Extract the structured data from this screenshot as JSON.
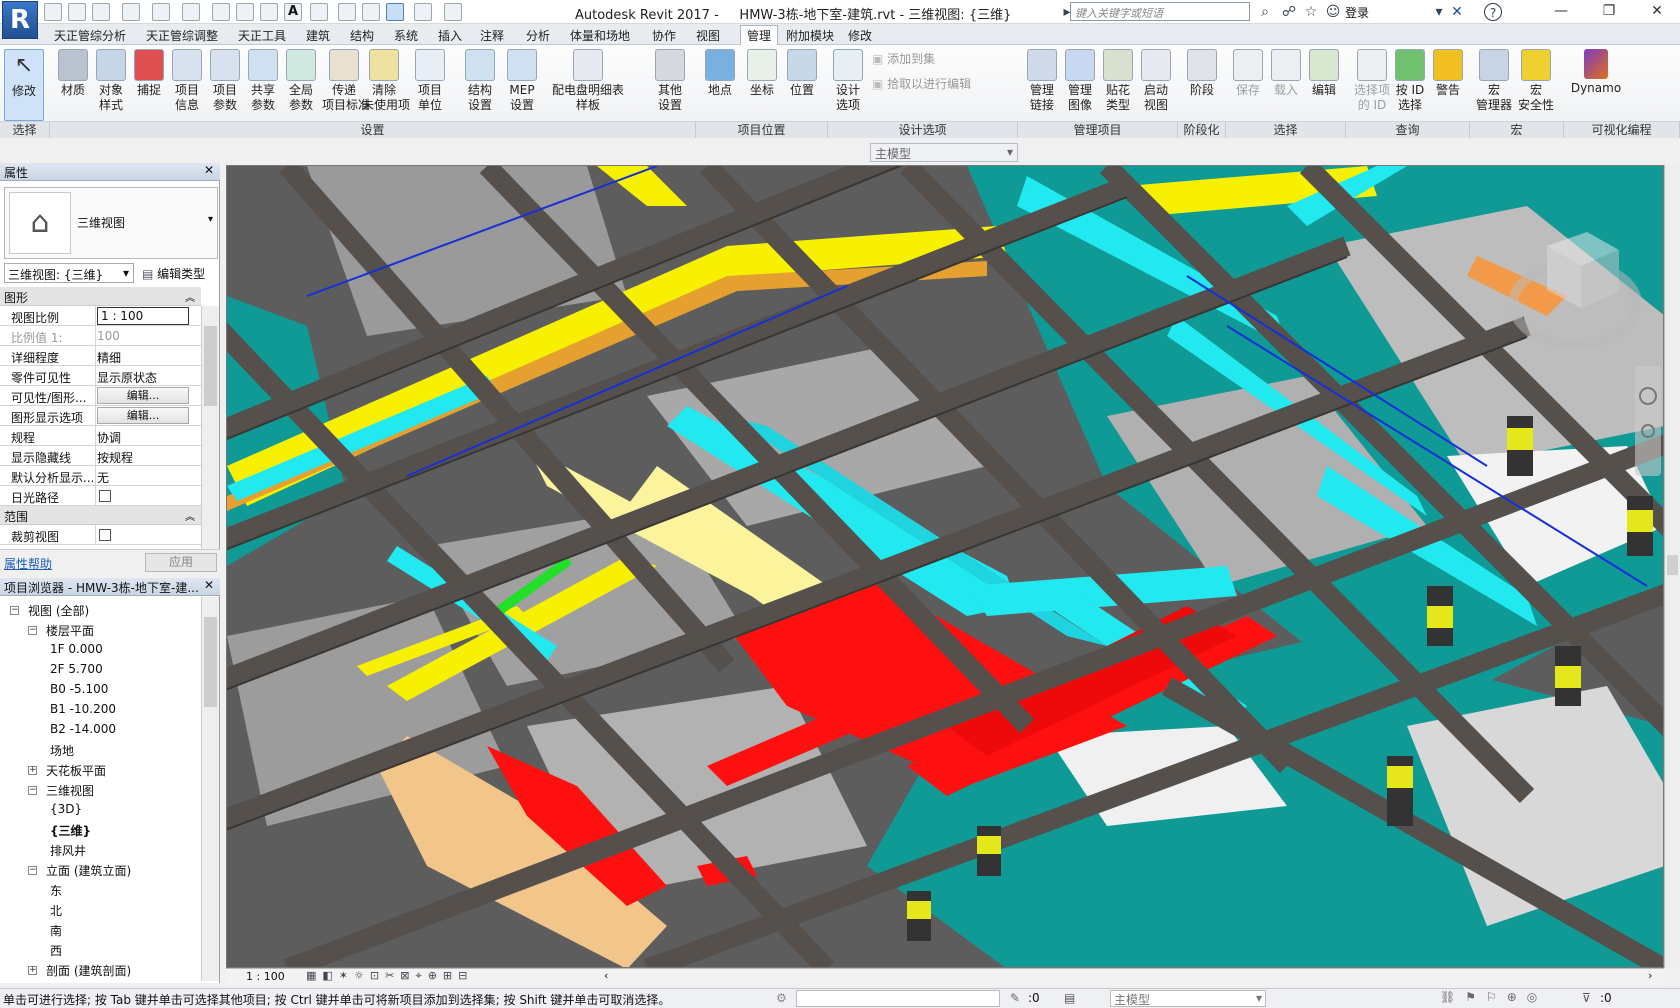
{
  "app": {
    "logo_letter": "R",
    "title": "Autodesk Revit 2017 -     HMW-3栋-地下室-建筑.rvt - 三维视图: {三维}",
    "search_placeholder": "键入关键字或短语",
    "login": "登录"
  },
  "tabs": [
    "天正管综分析",
    "天正管综调整",
    "天正工具",
    "建筑",
    "结构",
    "系统",
    "插入",
    "注释",
    "分析",
    "体量和场地",
    "协作",
    "视图",
    "管理",
    "附加模块",
    "修改"
  ],
  "active_tab": "管理",
  "ribbon": {
    "select": {
      "modify": "修改",
      "select_label": "选择 ▾"
    },
    "settings_buttons": [
      {
        "l1": "材质",
        "l2": ""
      },
      {
        "l1": "对象",
        "l2": "样式"
      },
      {
        "l1": "捕捉",
        "l2": ""
      },
      {
        "l1": "项目",
        "l2": "信息"
      },
      {
        "l1": "项目",
        "l2": "参数"
      },
      {
        "l1": "共享",
        "l2": "参数"
      },
      {
        "l1": "全局",
        "l2": "参数"
      },
      {
        "l1": "传递",
        "l2": "项目标准"
      },
      {
        "l1": "清除",
        "l2": "未使用项"
      },
      {
        "l1": "项目",
        "l2": "单位"
      },
      {
        "l1": "结构",
        "l2": "设置"
      },
      {
        "l1": "MEP",
        "l2": "设置"
      },
      {
        "l1": "配电盘明细表",
        "l2": "样板"
      },
      {
        "l1": "其他",
        "l2": "设置"
      }
    ],
    "location_buttons": [
      {
        "l1": "地点",
        "l2": ""
      },
      {
        "l1": "坐标",
        "l2": ""
      },
      {
        "l1": "位置",
        "l2": ""
      }
    ],
    "design_options": {
      "btn_l1": "设计",
      "btn_l2": "选项",
      "add_to_set": "添加到集",
      "pick_to_edit": "拾取以进行编辑",
      "main_model": "主模型"
    },
    "manage_project_buttons": [
      {
        "l1": "管理",
        "l2": "链接"
      },
      {
        "l1": "管理",
        "l2": "图像"
      },
      {
        "l1": "贴花",
        "l2": "类型"
      },
      {
        "l1": "启动",
        "l2": "视图"
      }
    ],
    "phase_button": {
      "l1": "阶段",
      "l2": ""
    },
    "selection_buttons": [
      {
        "l1": "保存",
        "l2": "",
        "disabled": true
      },
      {
        "l1": "载入",
        "l2": "",
        "disabled": true
      },
      {
        "l1": "编辑",
        "l2": "",
        "disabled": false
      }
    ],
    "inquiry_buttons": [
      {
        "l1": "选择项",
        "l2": "的 ID",
        "disabled": true
      },
      {
        "l1": "按 ID",
        "l2": "选择",
        "disabled": false
      },
      {
        "l1": "警告",
        "l2": "",
        "disabled": false
      }
    ],
    "macro_buttons": [
      {
        "l1": "宏",
        "l2": "管理器"
      },
      {
        "l1": "宏",
        "l2": "安全性"
      }
    ],
    "dynamo": "Dynamo",
    "panels": [
      "选择",
      "设置",
      "项目位置",
      "设计选项",
      "管理项目",
      "阶段化",
      "选择",
      "查询",
      "宏",
      "可视化编程"
    ]
  },
  "properties": {
    "title": "属性",
    "type_name": "三维视图",
    "instance_selector": "三维视图: {三维}",
    "edit_type": "编辑类型",
    "group_graphics": "图形",
    "rows": [
      {
        "k": "视图比例",
        "v": "1 : 100"
      },
      {
        "k": "比例值 1:",
        "v": "100"
      },
      {
        "k": "详细程度",
        "v": "精细"
      },
      {
        "k": "零件可见性",
        "v": "显示原状态"
      },
      {
        "k": "可见性/图形...",
        "v": "编辑..."
      },
      {
        "k": "图形显示选项",
        "v": "编辑..."
      },
      {
        "k": "规程",
        "v": "协调"
      },
      {
        "k": "显示隐藏线",
        "v": "按规程"
      },
      {
        "k": "默认分析显示...",
        "v": "无"
      },
      {
        "k": "日光路径",
        "v": ""
      }
    ],
    "group_extents": "范围",
    "crop_view": "裁剪视图",
    "help": "属性帮助",
    "apply": "应用"
  },
  "browser": {
    "title": "项目浏览器 - HMW-3栋-地下室-建...",
    "root": "视图 (全部)",
    "floor_plans": "楼层平面",
    "levels": [
      "1F  0.000",
      "2F  5.700",
      "B0 -5.100",
      "B1 -10.200",
      "B2  -14.000",
      "场地"
    ],
    "ceiling_plans": "天花板平面",
    "views_3d": "三维视图",
    "views_3d_items": [
      "{3D}",
      "{三维}",
      "排风井"
    ],
    "elevations": "立面 (建筑立面)",
    "elevation_items": [
      "东",
      "北",
      "南",
      "西"
    ],
    "sections": "剖面 (建筑剖面)"
  },
  "viewbar": {
    "scale": "1 : 100"
  },
  "status": {
    "message": "单击可进行选择; 按 Tab 键并单击可选择其他项目; 按 Ctrl 键并单击可将新项目添加到选择集; 按 Shift 键并单击可取消选择。",
    "workset_count": ":0",
    "main_model": "主模型",
    "filter_count": ":0"
  },
  "colors": {
    "ribbon_accent": "#2c6bb8",
    "yellow_duct": "#f7f100",
    "cyan_duct": "#22e8f0",
    "red_duct": "#ff1010",
    "pale_duct": "#fbf49c",
    "teal_floor": "#0f9a96",
    "beam": "#55504c"
  }
}
